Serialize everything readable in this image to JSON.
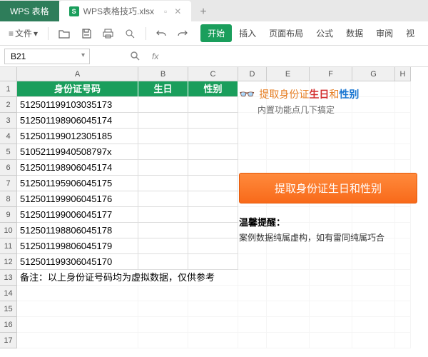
{
  "tabs": {
    "app": "WPS 表格",
    "file": "WPS表格技巧.xlsx",
    "add": "+"
  },
  "toolbar": {
    "file": "文件",
    "dd": "▾"
  },
  "menu": {
    "start": "开始",
    "insert": "插入",
    "layout": "页面布局",
    "formula": "公式",
    "data": "数据",
    "review": "审阅",
    "view": "视"
  },
  "namebox": "B21",
  "fx": "fx",
  "cols": [
    "A",
    "B",
    "C",
    "D",
    "E",
    "F",
    "G",
    "H"
  ],
  "headers": {
    "a": "身份证号码",
    "b": "生日",
    "c": "性别"
  },
  "rows": [
    "512501199103035173",
    "512501198906045174",
    "512501199012305185",
    "51052119940508797x",
    "512501198906045174",
    "512501195906045175",
    "512501199906045176",
    "512501199006045177",
    "512501198806045178",
    "512501199806045179",
    "512501199306045170"
  ],
  "note": "备注：以上身份证号码均为虚拟数据，仅供参考",
  "side": {
    "t1": "提取身份证",
    "t2": "生日",
    "t3": "和",
    "t4": "性别",
    "sub": "内置功能点几下搞定",
    "btn": "提取身份证生日和性别",
    "warn_t": "温馨提醒：",
    "warn_b": "案例数据纯属虚构，如有雷同纯属巧合"
  }
}
